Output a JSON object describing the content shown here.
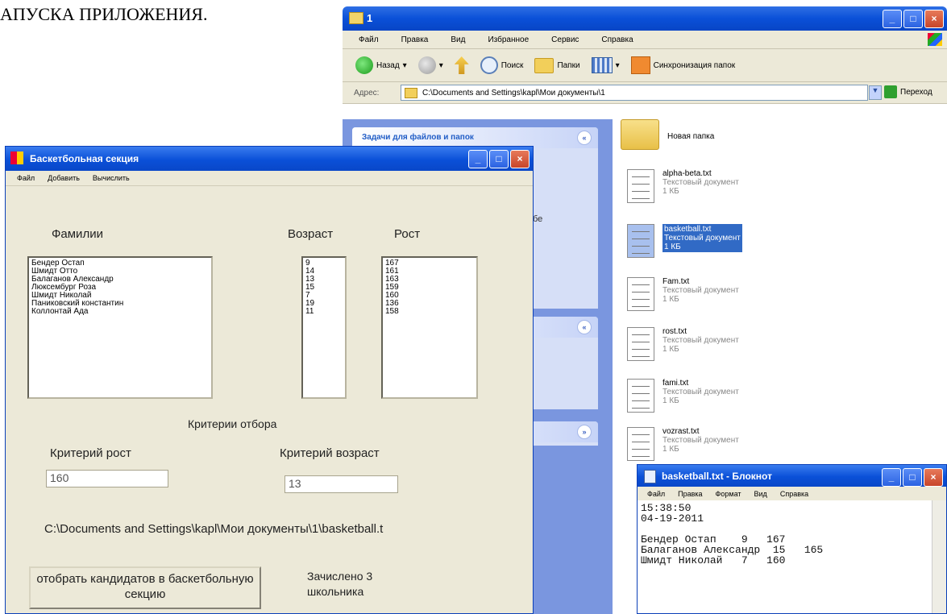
{
  "heading": "АПУСКА ПРИЛОЖЕНИЯ.",
  "explorer": {
    "title": "1",
    "menu": [
      "Файл",
      "Правка",
      "Вид",
      "Избранное",
      "Сервис",
      "Справка"
    ],
    "toolbar": {
      "back": "Назад",
      "search": "Поиск",
      "folders": "Папки",
      "sync": "Синхронизация папок"
    },
    "address_label": "Адрес:",
    "address": "C:\\Documents and Settings\\kapl\\Мои документы\\1",
    "go": "Переход",
    "tasks": [
      {
        "title": "Задачи для файлов и папок",
        "body": "ебе\nм"
      },
      {
        "title": "",
        "body": ""
      },
      {
        "title": "",
        "body": ""
      }
    ],
    "files": [
      {
        "name": "Новая папка",
        "type": "",
        "size": "",
        "kind": "folder"
      },
      {
        "name": "alpha-beta.txt",
        "type": "Текстовый документ",
        "size": "1 КБ",
        "kind": "doc"
      },
      {
        "name": "basketball.txt",
        "type": "Текстовый документ",
        "size": "1 КБ",
        "kind": "doc",
        "selected": true
      },
      {
        "name": "Fam.txt",
        "type": "Текстовый документ",
        "size": "1 КБ",
        "kind": "doc"
      },
      {
        "name": "rost.txt",
        "type": "Текстовый документ",
        "size": "1 КБ",
        "kind": "doc"
      },
      {
        "name": "fami.txt",
        "type": "Текстовый документ",
        "size": "1 КБ",
        "kind": "doc"
      },
      {
        "name": "vozrast.txt",
        "type": "Текстовый документ",
        "size": "1 КБ",
        "kind": "doc"
      }
    ]
  },
  "app": {
    "title": "Баскетбольная секция",
    "menu": [
      "Файл",
      "Добавить",
      "Вычислить"
    ],
    "labels": {
      "surnames": "Фамилии",
      "age": "Возраст",
      "height": "Рост",
      "criteria": "Критерии отбора",
      "crit_height": "Критерий рост",
      "crit_age": "Критерий возраст"
    },
    "surnames": [
      "Бендер Остап",
      "Шмидт Отто",
      "Балаганов Александр",
      "Люксембург Роза",
      "Шмидт Николай",
      "Паниковский константин",
      "Коллонтай Ада"
    ],
    "ages": [
      "9",
      "14",
      "13",
      "15",
      "7",
      "19",
      "11"
    ],
    "heights": [
      "167",
      "161",
      "163",
      "159",
      "160",
      "136",
      "158"
    ],
    "crit_height_value": "160",
    "crit_age_value": "13",
    "path": "C:\\Documents and Settings\\kapl\\Мои документы\\1\\basketball.t",
    "select_button": "отобрать кандидатов в баскетбольную секцию",
    "result": "Зачислено 3 школьника"
  },
  "notepad": {
    "title": "basketball.txt - Блокнот",
    "menu": [
      "Файл",
      "Правка",
      "Формат",
      "Вид",
      "Справка"
    ],
    "lines": [
      "15:38:50",
      "04-19-2011",
      "",
      "Бендер Остап    9   167",
      "Балаганов Александр  15   165",
      "Шмидт Николай   7   160"
    ]
  }
}
